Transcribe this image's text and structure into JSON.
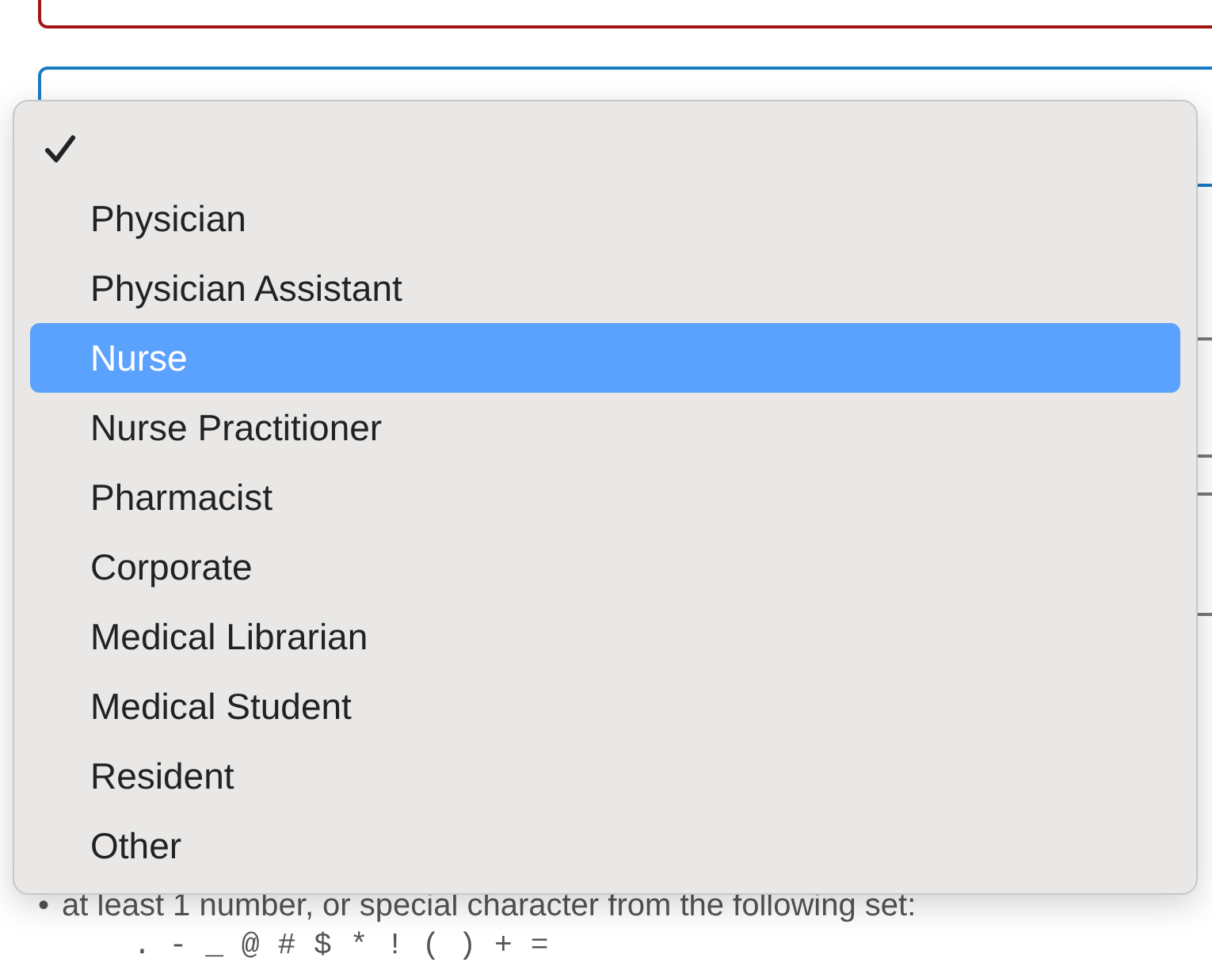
{
  "menu": {
    "items": [
      {
        "checked": true,
        "selected": false
      },
      {
        "label": "Physician",
        "checked": false,
        "selected": false
      },
      {
        "label": "Physician Assistant",
        "checked": false,
        "selected": false
      },
      {
        "label": "Nurse",
        "checked": false,
        "selected": true
      },
      {
        "label": "Nurse Practitioner",
        "checked": false,
        "selected": false
      },
      {
        "label": "Pharmacist",
        "checked": false,
        "selected": false
      },
      {
        "label": "Corporate",
        "checked": false,
        "selected": false
      },
      {
        "label": "Medical Librarian",
        "checked": false,
        "selected": false
      },
      {
        "label": "Medical Student",
        "checked": false,
        "selected": false
      },
      {
        "label": "Resident",
        "checked": false,
        "selected": false
      },
      {
        "label": "Other",
        "checked": false,
        "selected": false
      }
    ]
  },
  "password_rules": {
    "bullet": "•",
    "rule": "at least 1 number, or special character from the following set:",
    "characters": ". - _ @ # $ * ! ( ) + ="
  }
}
